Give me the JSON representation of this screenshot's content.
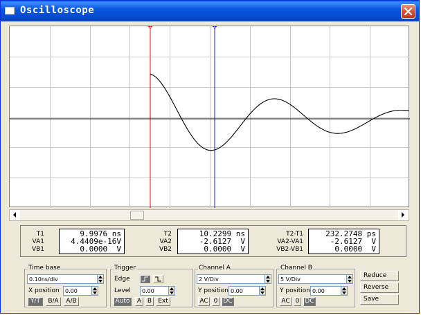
{
  "window": {
    "title": "Oscilloscope"
  },
  "cursors": {
    "t1_marker": "1",
    "t2_marker": "2",
    "t1_color": "#e81010",
    "t2_color": "#2020d0"
  },
  "readout": {
    "col1": {
      "labels": [
        "T1",
        "VA1",
        "VB1"
      ],
      "values": [
        "9.9976 ns",
        "4.4409e-16V",
        "0.0000  V"
      ]
    },
    "col2": {
      "labels": [
        "T2",
        "VA2",
        "VB2"
      ],
      "values": [
        "10.2299 ns",
        "-2.6127  V",
        "0.0000  V"
      ]
    },
    "col3": {
      "labels": [
        "T2-T1",
        "VA2-VA1",
        "VB2-VB1"
      ],
      "values": [
        "232.2748 ps",
        "-2.6127  V",
        "0.0000  V"
      ]
    }
  },
  "timebase": {
    "title": "Time base",
    "scale": "0.10ns/div",
    "xpos_label": "X position",
    "xpos_value": "0.00",
    "modes": [
      "Y/T",
      "B/A",
      "A/B"
    ],
    "selected_mode": "Y/T"
  },
  "trigger": {
    "title": "Trigger",
    "edge_label": "Edge",
    "level_label": "Level",
    "level_value": "0.00",
    "sources": [
      "Auto",
      "A",
      "B",
      "Ext"
    ],
    "selected_source": "Auto"
  },
  "channel_a": {
    "title": "Channel A",
    "scale": "2 V/Div",
    "ypos_label": "Y position",
    "ypos_value": "0.00",
    "coupling": [
      "AC",
      "0",
      "DC"
    ],
    "selected": "DC"
  },
  "channel_b": {
    "title": "Channel B",
    "scale": "5 V/Div",
    "ypos_label": "Y position",
    "ypos_value": "0.00",
    "coupling": [
      "AC",
      "0",
      "DC"
    ],
    "selected": "DC"
  },
  "side_buttons": {
    "reduce": "Reduce",
    "reverse": "Reverse",
    "save": "Save"
  },
  "trace": {
    "color": "#000000",
    "grid_color": "#c8c8c8"
  }
}
